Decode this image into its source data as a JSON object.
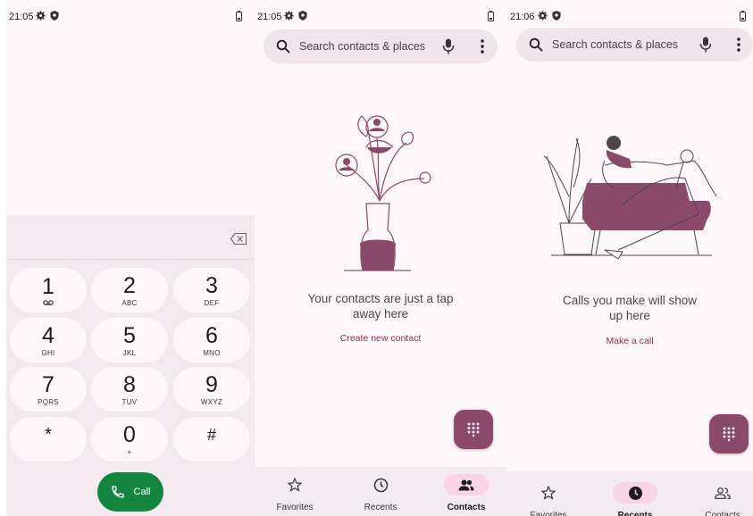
{
  "dialer": {
    "time": "21:05",
    "keys": [
      {
        "num": "1",
        "letters": ""
      },
      {
        "num": "2",
        "letters": "ABC"
      },
      {
        "num": "3",
        "letters": "DEF"
      },
      {
        "num": "4",
        "letters": "GHI"
      },
      {
        "num": "5",
        "letters": "JKL"
      },
      {
        "num": "6",
        "letters": "MNO"
      },
      {
        "num": "7",
        "letters": "PQRS"
      },
      {
        "num": "8",
        "letters": "TUV"
      },
      {
        "num": "9",
        "letters": "WXYZ"
      },
      {
        "num": "*",
        "letters": ""
      },
      {
        "num": "0",
        "letters": "+"
      },
      {
        "num": "#",
        "letters": ""
      }
    ],
    "call_label": "Call",
    "call_color": "#13853f"
  },
  "contacts_screen": {
    "time": "21:05",
    "search_placeholder": "Search contacts & places",
    "empty_message": "Your contacts are just a tap away here",
    "action_link": "Create new contact"
  },
  "recents_screen": {
    "time": "21:06",
    "search_placeholder": "Search contacts & places",
    "empty_message": "Calls you make will show up here",
    "action_link": "Make a call"
  },
  "nav": {
    "favorites": "Favorites",
    "recents": "Recents",
    "contacts": "Contacts"
  },
  "icons": {
    "status": [
      "gear-icon",
      "shield-icon",
      "battery-icon"
    ],
    "search": "search-icon",
    "mic": "mic-icon",
    "overflow": "more-vert-icon",
    "fab": "dialpad-icon",
    "backspace": "backspace-icon",
    "voicemail": "voicemail-icon",
    "phone": "phone-icon"
  },
  "colors": {
    "accent": "#8b4a69",
    "link": "#8a2c57",
    "nav_active_pill": "#f8d4e5",
    "surface": "#fef7fa"
  }
}
